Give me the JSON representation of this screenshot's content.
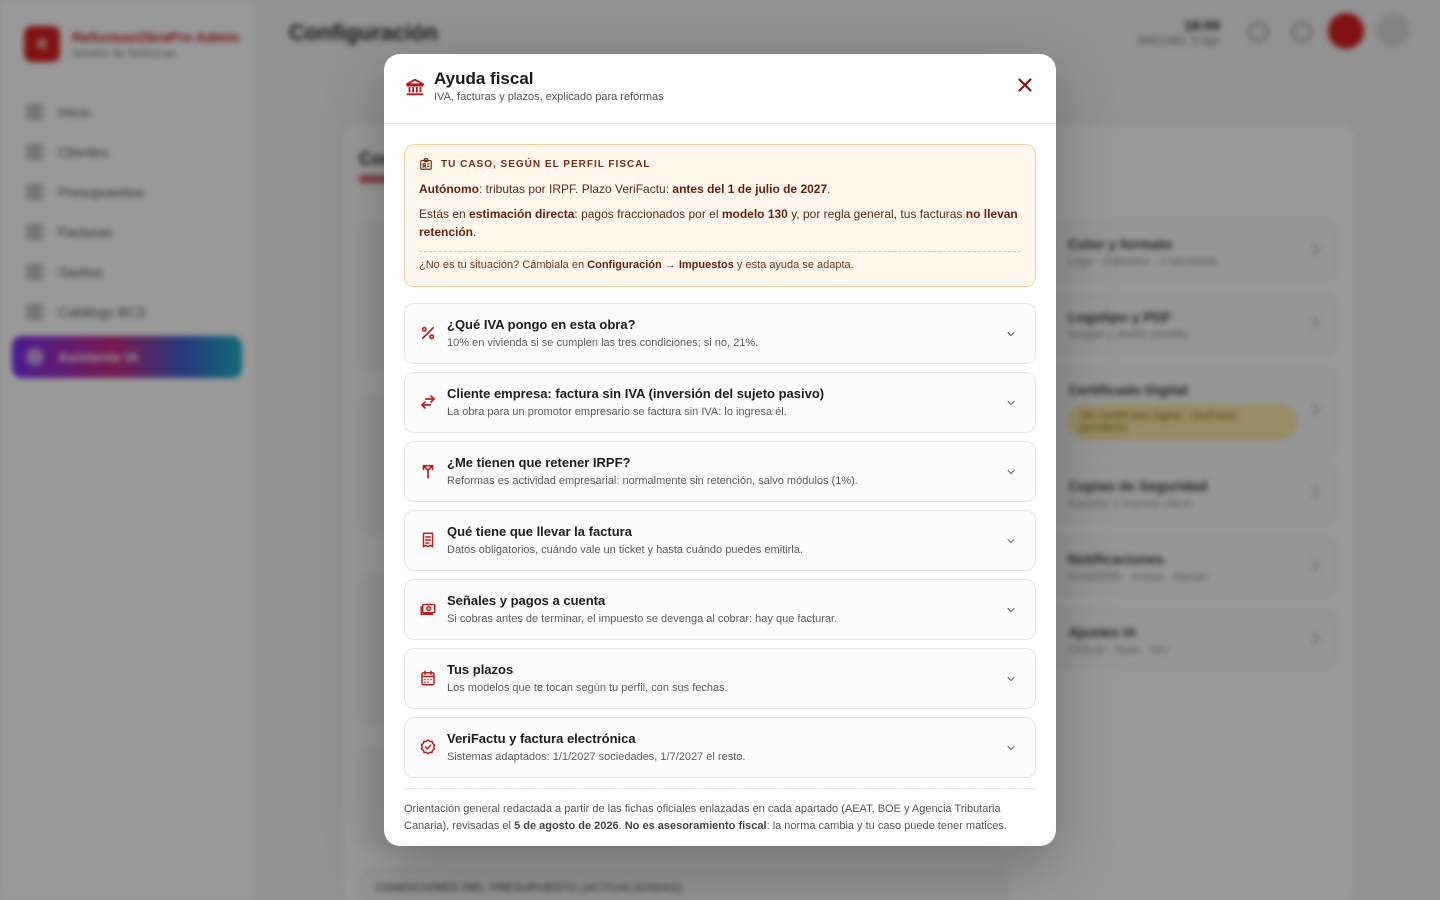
{
  "app": {
    "brand_name": "ReformasObraPro Admin",
    "brand_sub": "Gestión de Reformas",
    "logo_letter": "R",
    "page_title": "Configuración",
    "clock_time": "18:00",
    "clock_date": "Miércoles, 5 Ago",
    "nav": [
      {
        "label": "Inicio"
      },
      {
        "label": "Clientes"
      },
      {
        "label": "Presupuestos"
      },
      {
        "label": "Facturas"
      },
      {
        "label": "Gastos"
      },
      {
        "label": "Catálogo BC3"
      },
      {
        "label": "Asistente IA"
      }
    ],
    "section_title": "Configuración",
    "right_items": [
      {
        "title": "Color y formato",
        "sub": "Logo · Cabecera · 4 secciones"
      },
      {
        "title": "Logotipo y PDF",
        "sub": "Imagen y diseño plantilla"
      },
      {
        "title": "Certificado Digital",
        "sub": "Sin certificado digital · VeriFactu pendiente"
      },
      {
        "title": "Copias de Seguridad",
        "sub": "Exportar e importar datos"
      },
      {
        "title": "Notificaciones",
        "sub": "Email/SMS · Avisos · Alertas"
      },
      {
        "title": "Ajustes IA",
        "sub": "Chat IA · Texto · Voz"
      }
    ],
    "bottom_strip": "CONDICIONES DEL PRESUPUESTO (ACTUALIZADAS)"
  },
  "modal": {
    "title": "Ayuda fiscal",
    "subtitle": "IVA, facturas y plazos, explicado para reformas",
    "close_icon": "close-icon",
    "profile": {
      "heading": "TU CASO, SEGÚN EL PERFIL FISCAL",
      "l1_b1": "Autónomo",
      "l1_t1": ": tributas por IRPF. Plazo VeriFactu: ",
      "l1_b2": "antes del 1 de julio de 2027",
      "l1_t2": ".",
      "l2_t1": "Estás en ",
      "l2_b1": "estimación directa",
      "l2_t2": ": pagos fraccionados por el ",
      "l2_b2": "modelo 130",
      "l2_t3": " y, por regla general, tus facturas ",
      "l2_b3": "no llevan retención",
      "l2_t4": ".",
      "note_t1": "¿No es tu situación? Cámbiala en ",
      "note_b1": "Configuración",
      "note_t2": " → ",
      "note_b2": "Impuestos",
      "note_t3": " y esta ayuda se adapta."
    },
    "sections": [
      {
        "icon": "percent-icon",
        "title": "¿Qué IVA pongo en esta obra?",
        "sub": "10% en vivienda si se cumplen las tres condiciones; si no, 21%."
      },
      {
        "icon": "swap-arrows-icon",
        "title": "Cliente empresa: factura sin IVA (inversión del sujeto pasivo)",
        "sub": "La obra para un promotor empresario se factura sin IVA: lo ingresa él."
      },
      {
        "icon": "split-arrow-icon",
        "title": "¿Me tienen que retener IRPF?",
        "sub": "Reformas es actividad empresarial: normalmente sin retención, salvo módulos (1%)."
      },
      {
        "icon": "receipt-icon",
        "title": "Qué tiene que llevar la factura",
        "sub": "Datos obligatorios, cuándo vale un ticket y hasta cuándo puedes emitirla."
      },
      {
        "icon": "money-icon",
        "title": "Señales y pagos a cuenta",
        "sub": "Si cobras antes de terminar, el impuesto se devenga al cobrar: hay que facturar."
      },
      {
        "icon": "calendar-icon",
        "title": "Tus plazos",
        "sub": "Los modelos que te tocan según tu perfil, con sus fechas."
      },
      {
        "icon": "verified-badge-icon",
        "title": "VeriFactu y factura electrónica",
        "sub": "Sistemas adaptados: 1/1/2027 sociedades, 1/7/2027 el resto."
      }
    ],
    "footnote": {
      "t1": "Orientación general redactada a partir de las fichas oficiales enlazadas en cada apartado (AEAT, BOE y Agencia Tributaria Canaria), revisadas el ",
      "b1": "5 de agosto de 2026",
      "t2": ". ",
      "b2": "No es asesoramiento fiscal",
      "t3": ": la norma cambia y tu caso puede tener matices."
    }
  },
  "colors": {
    "accent": "#c41a1a",
    "profile_bg": "#fff6ec",
    "profile_border": "#f3cfa5"
  }
}
